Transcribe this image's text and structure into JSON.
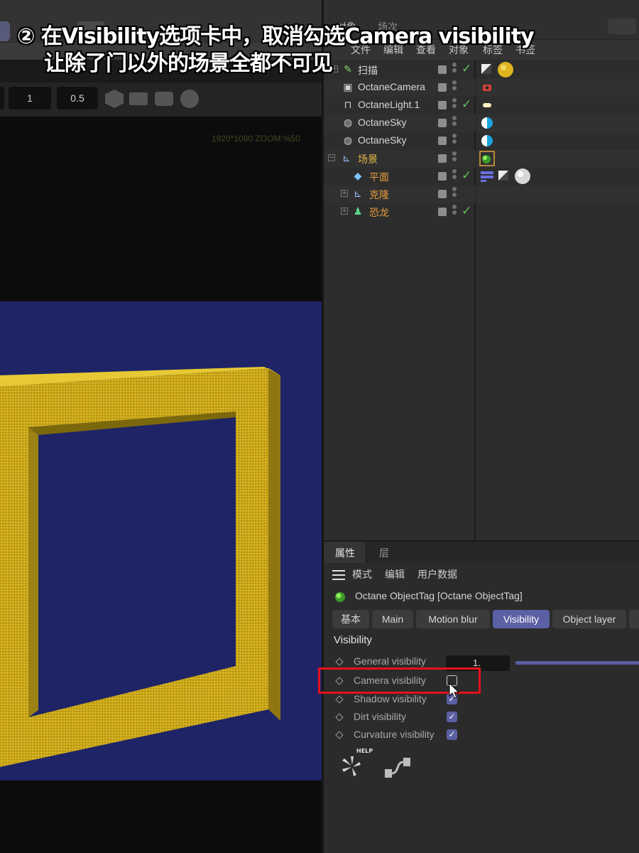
{
  "caption": {
    "line1": "② 在Visibility选项卡中，取消勾选Camera visibility",
    "line2": "让除了门以外的场景全都不可见"
  },
  "viewport": {
    "fields": [
      "1",
      "0.5"
    ],
    "resolution": "1920*1080 ZOOM:%50"
  },
  "object_manager": {
    "tabs": [
      "对象",
      "场次"
    ],
    "menu": [
      "文件",
      "编辑",
      "查看",
      "对象",
      "标签",
      "书签"
    ],
    "objects": [
      {
        "name": "扫描",
        "icon": "sweep-icon",
        "check": true,
        "expand": "+"
      },
      {
        "name": "OctaneCamera",
        "icon": "camera-icon",
        "check": false,
        "expand": ""
      },
      {
        "name": "OctaneLight.1",
        "icon": "light-icon",
        "check": true,
        "expand": ""
      },
      {
        "name": "OctaneSky",
        "icon": "sky-icon",
        "check": false,
        "expand": ""
      },
      {
        "name": "OctaneSky",
        "icon": "sky-icon",
        "check": false,
        "expand": ""
      },
      {
        "name": "场景",
        "icon": "null-icon",
        "check": false,
        "expand": "−"
      },
      {
        "name": "平面",
        "icon": "plane-icon",
        "check": true,
        "expand": ""
      },
      {
        "name": "克隆",
        "icon": "cloner-icon",
        "check": false,
        "expand": "+"
      },
      {
        "name": "恐龙",
        "icon": "figure-icon",
        "check": true,
        "expand": "+"
      }
    ]
  },
  "attributes": {
    "tabs": [
      "属性",
      "层"
    ],
    "menu": [
      "模式",
      "编辑",
      "用户数据"
    ],
    "tag_title": "Octane ObjectTag [Octane ObjectTag]",
    "prop_tabs": [
      "基本",
      "Main",
      "Motion blur",
      "Visibility",
      "Object layer"
    ],
    "active_prop_tab": "Visibility",
    "section": "Visibility",
    "general_visibility_label": "General visibility",
    "general_visibility_value": "1.",
    "checkboxes": [
      {
        "label": "Camera visibility",
        "checked": false
      },
      {
        "label": "Shadow visibility",
        "checked": true
      },
      {
        "label": "Dirt visibility",
        "checked": true
      },
      {
        "label": "Curvature visibility",
        "checked": true
      }
    ],
    "help_label": "HELP"
  },
  "colors": {
    "accent": "#5b5fa3",
    "highlight": "#e5121b",
    "check_green": "#62c25a",
    "frame_gold": "#d6b21c",
    "render_bg": "#1e2466"
  }
}
